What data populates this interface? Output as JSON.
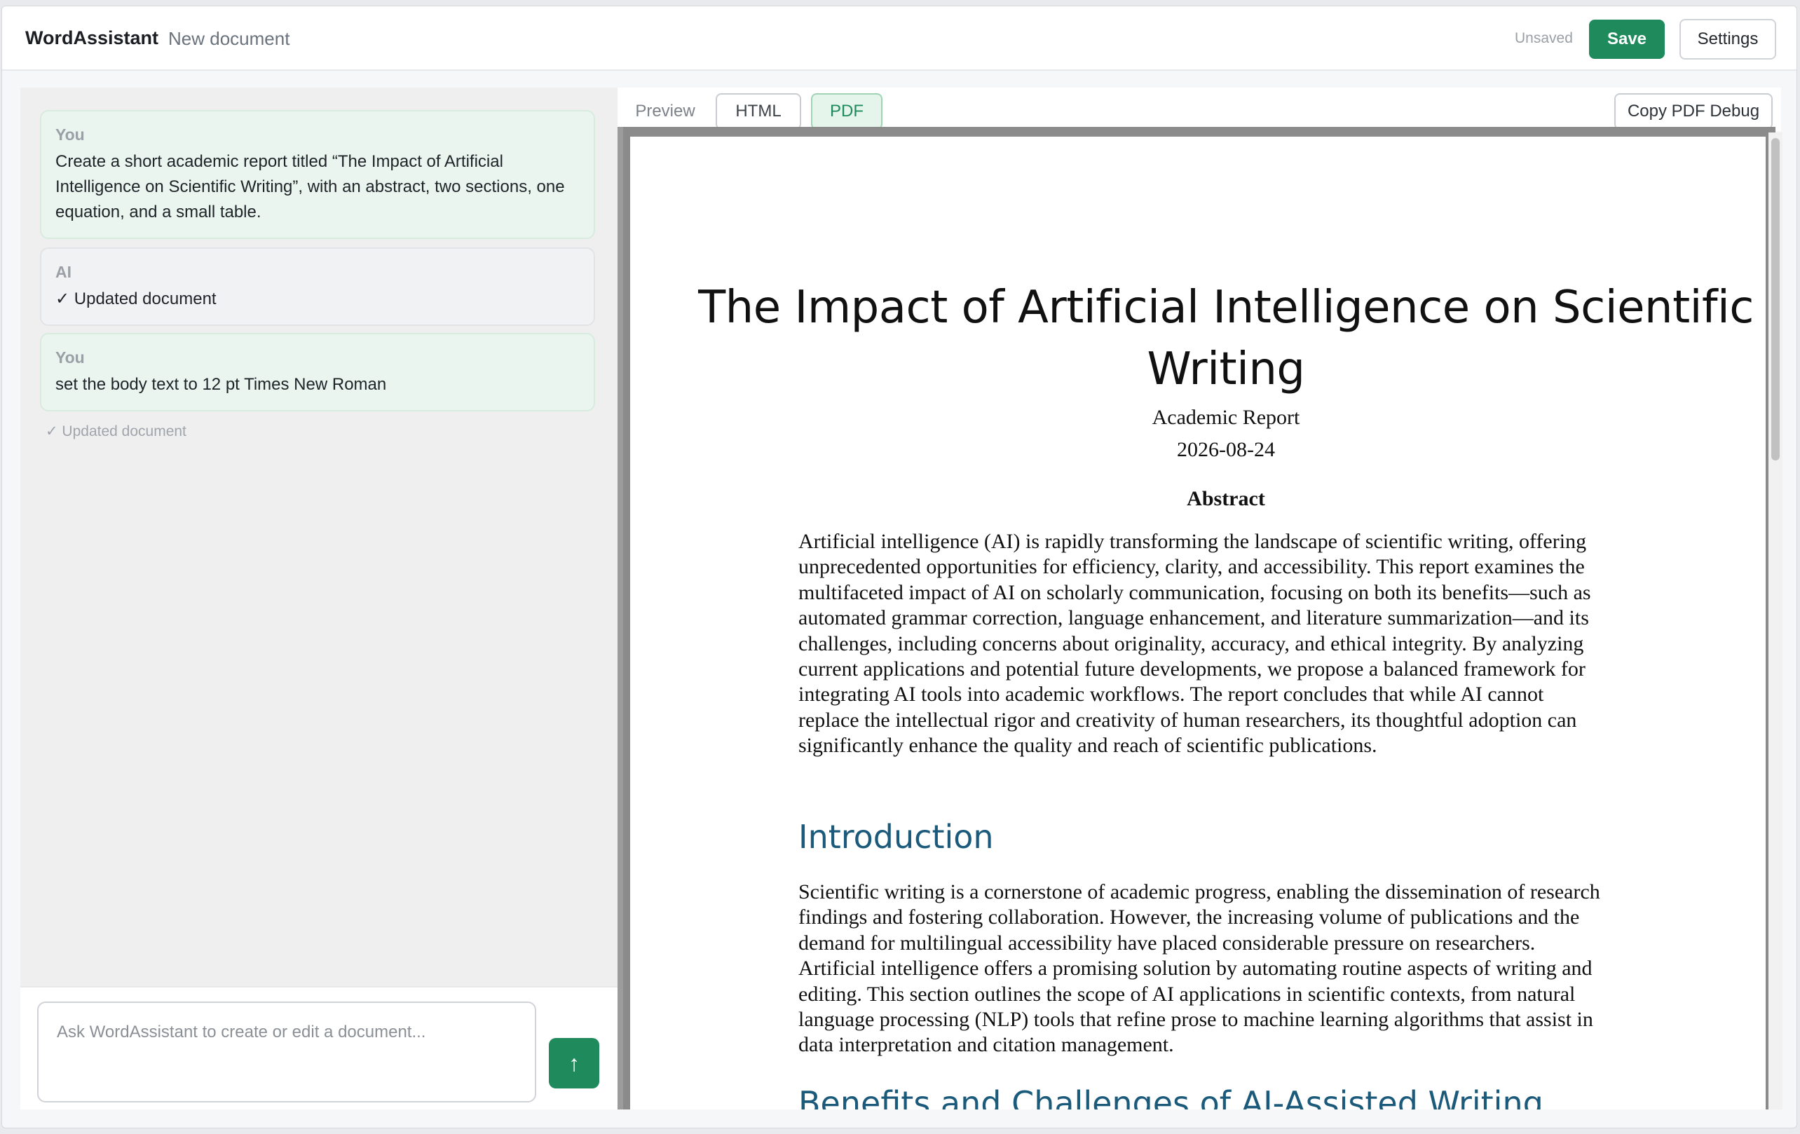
{
  "header": {
    "app_title": "WordAssistant",
    "doc_name": "New document",
    "status": "Unsaved",
    "save_label": "Save",
    "settings_label": "Settings"
  },
  "chat": {
    "messages": [
      {
        "role": "You",
        "text": "Create a short academic report titled “The Impact of Artificial Intelligence on Scientific Writing”, with an abstract, two sections, one equation, and a small table."
      },
      {
        "role": "AI",
        "text": "✓ Updated document"
      },
      {
        "role": "You",
        "text": "set the body text to 12 pt Times New Roman"
      }
    ],
    "status_line": "✓ Updated document",
    "input_placeholder": "Ask WordAssistant to create or edit a document...",
    "send_icon": "↑"
  },
  "viewer": {
    "tabs": [
      "Preview",
      "HTML",
      "PDF"
    ],
    "active_tab": "PDF",
    "debug_label": "Copy PDF Debug"
  },
  "document": {
    "title": "The Impact of Artificial Intelligence on Scientific Writing",
    "subtitle": "Academic Report",
    "date": "2026-08-24",
    "abstract_heading": "Abstract",
    "abstract": "Artificial intelligence (AI) is rapidly transforming the landscape of scientific writing, offering unprecedented opportunities for efficiency, clarity, and accessibility. This report examines the multifaceted impact of AI on scholarly communication, focusing on both its benefits—such as automated grammar correction, language enhancement, and literature summarization—and its challenges, including concerns about originality, accuracy, and ethical integrity. By analyzing current applications and potential future developments, we propose a balanced framework for integrating AI tools into academic workflows. The report concludes that while AI cannot replace the intellectual rigor and creativity of human researchers, its thoughtful adoption can significantly enhance the quality and reach of scientific publications.",
    "section1_heading": "Introduction",
    "section1_text": "Scientific writing is a cornerstone of academic progress, enabling the dissemination of research findings and fostering collaboration. However, the increasing volume of publications and the demand for multilingual accessibility have placed considerable pressure on researchers. Artificial intelligence offers a promising solution by automating routine aspects of writing and editing. This section outlines the scope of AI applications in scientific contexts, from natural language processing (NLP) tools that refine prose to machine learning algorithms that assist in data interpretation and citation management.",
    "section2_heading": "Benefits and Challenges of AI-Assisted Writing"
  },
  "colors": {
    "accent": "#1f8a5b",
    "heading_blue": "#1b5a7a",
    "user_bubble": "#e9f5ee"
  }
}
